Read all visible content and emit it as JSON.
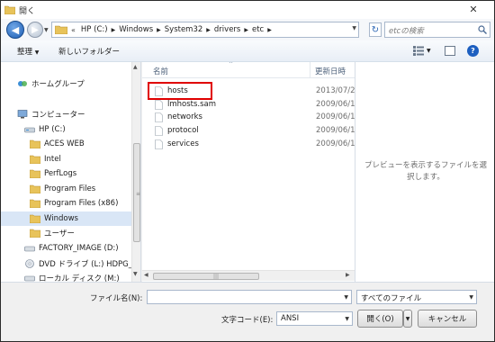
{
  "window": {
    "title": "開く",
    "close_glyph": "✕"
  },
  "navigation": {
    "back_glyph": "◀",
    "forward_glyph": "▶",
    "recent_glyph": "▼",
    "address_lead": "«",
    "breadcrumbs": [
      "HP (C:)",
      "Windows",
      "System32",
      "drivers",
      "etc"
    ],
    "breadcrumb_sep": "▶",
    "address_dropdown_glyph": "▼",
    "refresh_glyph": "↻",
    "search_placeholder": "etcの検索"
  },
  "toolbar": {
    "organize_label": "整理",
    "organize_arrow": "▼",
    "new_folder_label": "新しいフォルダー",
    "view_arrow": "▼",
    "help_glyph": "?"
  },
  "nav_pane": {
    "items": [
      {
        "label": "ホームグループ",
        "icon": "homegroup-icon"
      },
      {
        "label": "コンピューター",
        "icon": "computer-icon"
      },
      {
        "label": "HP (C:)",
        "icon": "drive-icon"
      },
      {
        "label": "ACES WEB",
        "icon": "folder-icon"
      },
      {
        "label": "Intel",
        "icon": "folder-icon"
      },
      {
        "label": "PerfLogs",
        "icon": "folder-icon"
      },
      {
        "label": "Program Files",
        "icon": "folder-icon"
      },
      {
        "label": "Program Files (x86)",
        "icon": "folder-icon"
      },
      {
        "label": "Windows",
        "icon": "folder-icon",
        "selected": true
      },
      {
        "label": "ユーザー",
        "icon": "folder-icon"
      },
      {
        "label": "FACTORY_IMAGE (D:)",
        "icon": "drive-icon"
      },
      {
        "label": "DVD ドライブ (L:) HDPG_",
        "icon": "dvd-drive-icon"
      },
      {
        "label": "ローカル ディスク (M:)",
        "icon": "drive-icon"
      }
    ],
    "scroll_up": "▲",
    "scroll_down": "▼",
    "grip": "≡"
  },
  "file_list": {
    "columns": {
      "name": "名前",
      "date": "更新日時"
    },
    "sort_indicator": "^",
    "rows": [
      {
        "name": "hosts",
        "date": "2013/07/2",
        "highlighted": true
      },
      {
        "name": "lmhosts.sam",
        "date": "2009/06/1"
      },
      {
        "name": "networks",
        "date": "2009/06/1"
      },
      {
        "name": "protocol",
        "date": "2009/06/1"
      },
      {
        "name": "services",
        "date": "2009/06/1"
      }
    ],
    "hscroll_left": "◀",
    "hscroll_right": "▶",
    "hscroll_grip": "|||"
  },
  "preview": {
    "message": "プレビューを表示するファイルを選択します。"
  },
  "bottom": {
    "filename_label": "ファイル名(N):",
    "filename_value": "",
    "filename_arrow": "▼",
    "filetype_value": "すべてのファイル",
    "filetype_arrow": "▼",
    "encoding_label": "文字コード(E):",
    "encoding_value": "ANSI",
    "encoding_arrow": "▼",
    "open_label": "開く(O)",
    "open_arrow": "▼",
    "cancel_label": "キャンセル"
  },
  "colors": {
    "highlight_border": "#e00000",
    "selected_bg": "#d9e6f6",
    "folder": "#e8c35a"
  }
}
